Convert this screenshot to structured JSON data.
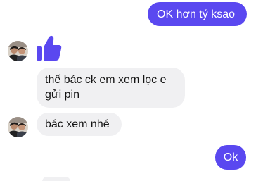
{
  "conversation": {
    "messages": [
      {
        "direction": "outgoing",
        "text": "OK hơn tý ksao"
      },
      {
        "direction": "incoming",
        "type": "like",
        "icon": "thumbs-up-icon"
      },
      {
        "direction": "incoming",
        "text": "thế bác ck em xem lọc e gửi pin"
      },
      {
        "direction": "incoming",
        "text": "bác xem nhé"
      },
      {
        "direction": "outgoing",
        "text": "Ok"
      }
    ]
  },
  "colors": {
    "outgoing_bubble": "#5a48f0",
    "incoming_bubble": "#f0f0f2",
    "like_icon": "#5a48f0"
  }
}
